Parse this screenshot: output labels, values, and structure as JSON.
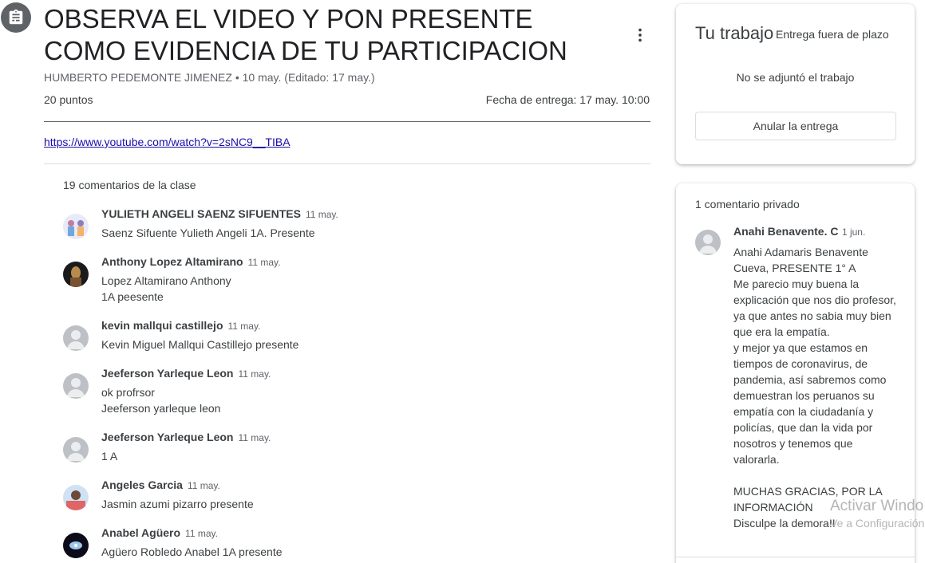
{
  "assignment": {
    "title": "OBSERVA EL VIDEO Y PON PRESENTE COMO EVIDENCIA DE TU PARTICIPACION",
    "meta": "HUMBERTO PEDEMONTE JIMENEZ • 10 may. (Editado: 17 may.)",
    "points": "20 puntos",
    "due": "Fecha de entrega: 17 may. 10:00",
    "link": "https://www.youtube.com/watch?v=2sNC9__TIBA"
  },
  "class_comments": {
    "heading": "19 comentarios de la clase",
    "items": [
      {
        "name": "YULIETH ANGELI SAENZ SIFUENTES",
        "date": "11 may.",
        "text": "Saenz Sifuente Yulieth Angeli 1A. Presente",
        "avatar": "photo"
      },
      {
        "name": "Anthony Lopez Altamirano",
        "date": "11 may.",
        "text": "Lopez Altamirano Anthony\n1A peesente",
        "avatar": "photo"
      },
      {
        "name": "kevin mallqui castillejo",
        "date": "11 may.",
        "text": "Kevin Miguel Mallqui Castillejo presente",
        "avatar": "default"
      },
      {
        "name": "Jeeferson Yarleque Leon",
        "date": "11 may.",
        "text": "ok profrsor\nJeeferson yarleque leon",
        "avatar": "default"
      },
      {
        "name": "Jeeferson Yarleque Leon",
        "date": "11 may.",
        "text": "1 A",
        "avatar": "default"
      },
      {
        "name": "Angeles Garcia",
        "date": "11 may.",
        "text": "Jasmin azumi pizarro presente",
        "avatar": "photo"
      },
      {
        "name": "Anabel Agüero",
        "date": "11 may.",
        "text": "Agüero Robledo Anabel 1A presente",
        "avatar": "photo"
      }
    ]
  },
  "your_work": {
    "title": "Tu trabajo",
    "status": "Entrega fuera de plazo",
    "no_attachment": "No se adjuntó el trabajo",
    "unsubmit_label": "Anular la entrega"
  },
  "private_comments": {
    "heading": "1 comentario privado",
    "name": "Anahi Benavente. C",
    "date": "1 jun.",
    "text": "Anahi Adamaris Benavente Cueva, PRESENTE 1° A\nMe parecio muy buena la explicación que nos dio profesor, ya que antes no sabia muy bien que era la empatía.\ny mejor ya que estamos en tiempos de coronavirus, de pandemia, así sabremos como demuestran los peruanos su empatía con la ciudadanía y policías, que dan la vida por nosotros y tenemos que valorarla.\n\nMUCHAS GRACIAS, POR LA INFORMACIÓN\nDisculpe la demora!!"
  },
  "watermark": {
    "line1": "Activar Windo",
    "line2": "Ve a Configuración"
  },
  "colors": {
    "text": "#3c4043",
    "muted": "#5f6368",
    "link": "#1a0dab",
    "icon_bg": "#5f6368"
  }
}
